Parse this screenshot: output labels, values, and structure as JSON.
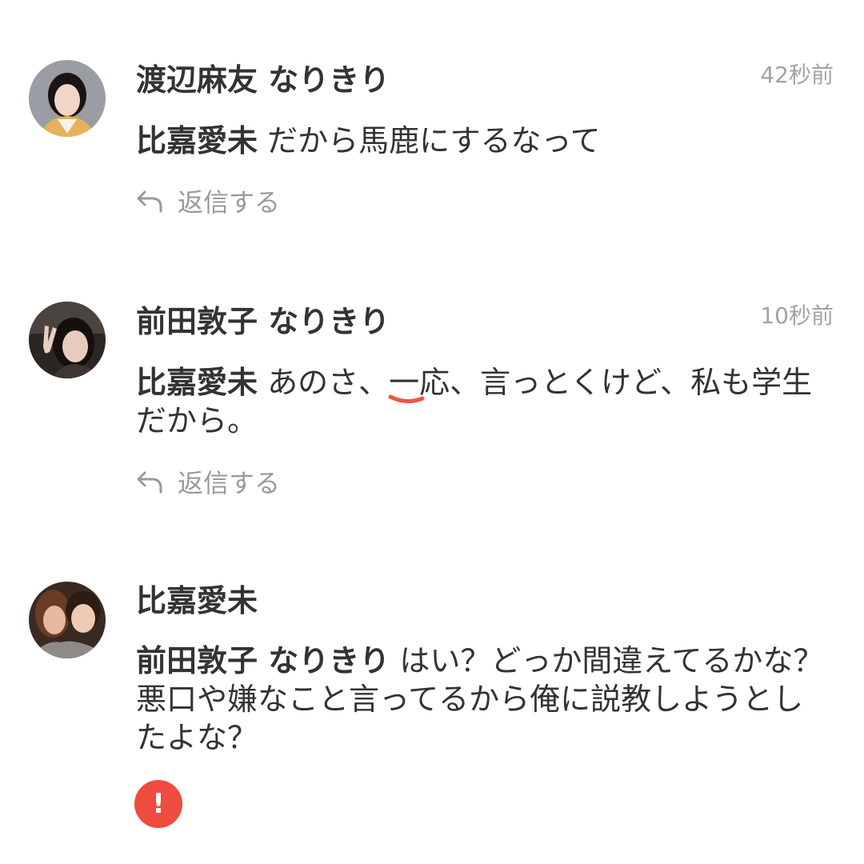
{
  "comments": [
    {
      "author": "渡辺麻友 なりきり",
      "time": "42秒前",
      "mention": "比嘉愛未",
      "text": " だから馬鹿にするなって",
      "reply_label": "返信する"
    },
    {
      "author": "前田敦子 なりきり",
      "time": "10秒前",
      "mention": "比嘉愛未",
      "text_before": " あのさ、",
      "text_marked": "一",
      "text_after": "応、言っとくけど、私も学生だから。",
      "reply_label": "返信する"
    },
    {
      "author": "比嘉愛未",
      "mention": "前田敦子 なりきり",
      "text": " はい？どっか間違えてるかな？悪口や嫌なこと言ってるから俺に説教しようとしたよな？",
      "alert_glyph": "!"
    }
  ],
  "icons": {
    "reply": "reply-arrow-icon",
    "alert": "alert-icon"
  },
  "colors": {
    "text": "#333333",
    "muted": "#a3a3a3",
    "alert": "#f04b3f"
  }
}
